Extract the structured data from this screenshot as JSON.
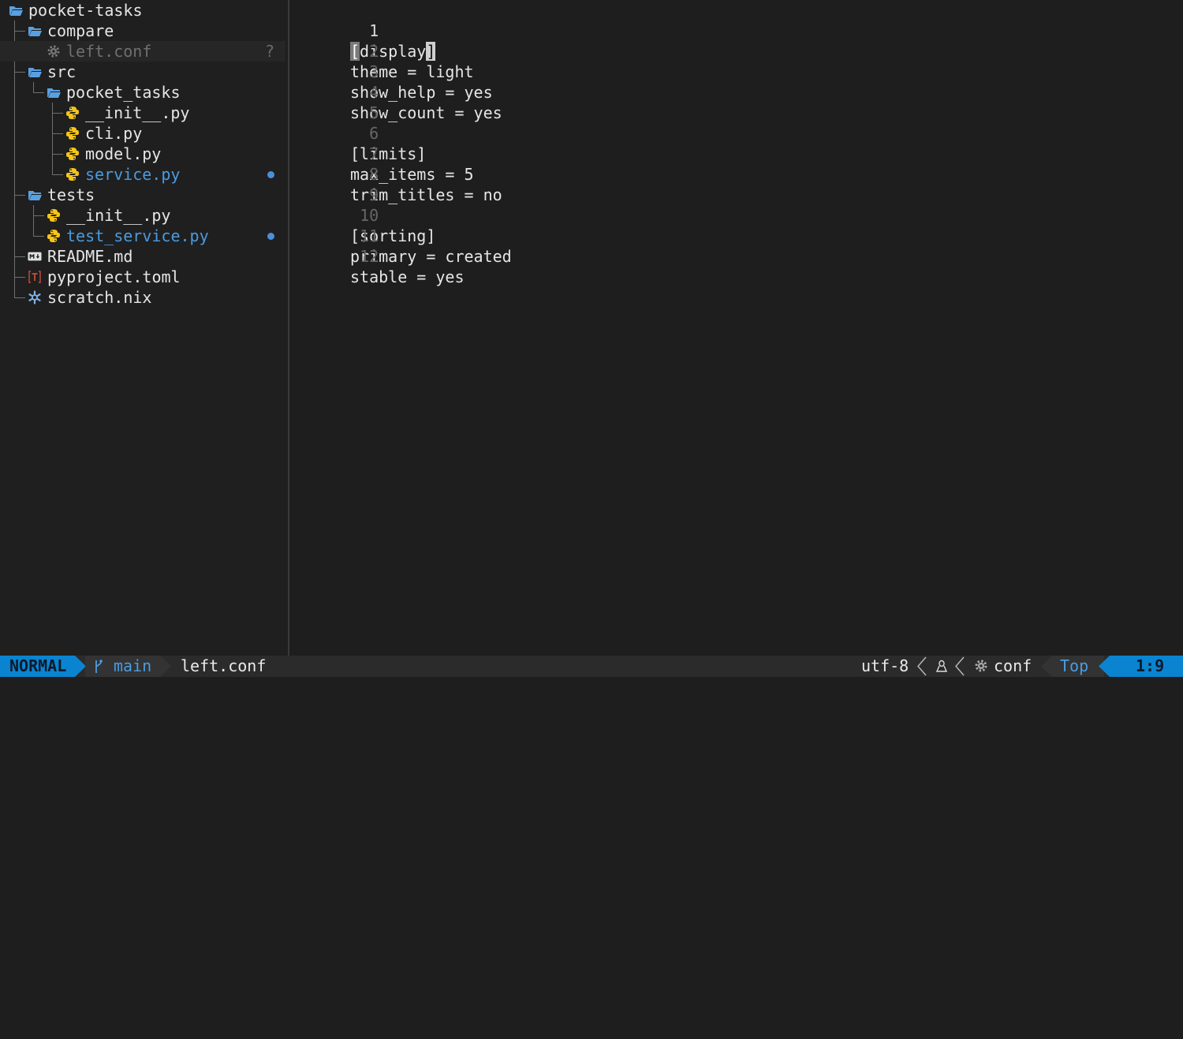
{
  "file_tree": {
    "root": "pocket-tasks",
    "items": [
      {
        "name": "compare",
        "type": "folder"
      },
      {
        "name": "left.conf",
        "type": "conf",
        "status": "?"
      },
      {
        "name": "src",
        "type": "folder"
      },
      {
        "name": "pocket_tasks",
        "type": "folder"
      },
      {
        "name": "__init__.py",
        "type": "python"
      },
      {
        "name": "cli.py",
        "type": "python"
      },
      {
        "name": "model.py",
        "type": "python"
      },
      {
        "name": "service.py",
        "type": "python",
        "modified": true
      },
      {
        "name": "tests",
        "type": "folder"
      },
      {
        "name": "__init__.py",
        "type": "python"
      },
      {
        "name": "test_service.py",
        "type": "python",
        "modified": true
      },
      {
        "name": "README.md",
        "type": "markdown"
      },
      {
        "name": "pyproject.toml",
        "type": "toml"
      },
      {
        "name": "scratch.nix",
        "type": "nix"
      }
    ]
  },
  "editor": {
    "lines": [
      {
        "num": "1",
        "pre": "",
        "c1": "[",
        "mid": "display",
        "c2": "]",
        "post": ""
      },
      {
        "num": "2",
        "text": "theme = light"
      },
      {
        "num": "3",
        "text": "show_help = yes"
      },
      {
        "num": "4",
        "text": "show_count = yes"
      },
      {
        "num": "5",
        "text": ""
      },
      {
        "num": "6",
        "text": "[limits]"
      },
      {
        "num": "7",
        "text": "max_items = 5"
      },
      {
        "num": "8",
        "text": "trim_titles = no"
      },
      {
        "num": "9",
        "text": ""
      },
      {
        "num": "10",
        "text": "[sorting]"
      },
      {
        "num": "11",
        "text": "primary = created"
      },
      {
        "num": "12",
        "text": "stable = yes"
      }
    ]
  },
  "statusline": {
    "mode": "NORMAL",
    "branch": "main",
    "filename": "left.conf",
    "encoding": "utf-8",
    "filetype": "conf",
    "position_label": "Top",
    "cursor": "1:9"
  },
  "colors": {
    "accent": "#0a84d0",
    "folder": "#5aa0e0",
    "python": "#f5c518",
    "modified": "#4a90d9",
    "toml": "#c0503a"
  }
}
